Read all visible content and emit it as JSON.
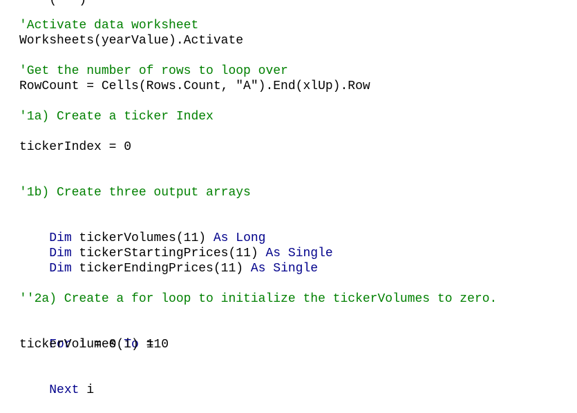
{
  "editor": {
    "clipped_top_fragment": "    (   )",
    "lines": [
      {
        "id": "c1",
        "text": "'Activate data worksheet"
      },
      {
        "id": "l1",
        "text": "Worksheets(yearValue).Activate"
      },
      {
        "id": "c2",
        "text": "'Get the number of rows to loop over"
      },
      {
        "id": "l2",
        "text": "RowCount = Cells(Rows.Count, \"A\").End(xlUp).Row"
      },
      {
        "id": "c3",
        "text": "'1a) Create a ticker Index"
      },
      {
        "id": "l3",
        "text": "tickerIndex = 0"
      },
      {
        "id": "c4",
        "text": "'1b) Create three output arrays"
      },
      {
        "id": "d1_kw",
        "text": "Dim"
      },
      {
        "id": "d1_name",
        "text": " tickerVolumes(11) "
      },
      {
        "id": "d1_type",
        "text": "As Long"
      },
      {
        "id": "d2_kw",
        "text": "Dim"
      },
      {
        "id": "d2_name",
        "text": " tickerStartingPrices(11) "
      },
      {
        "id": "d2_type",
        "text": "As Single"
      },
      {
        "id": "d3_kw",
        "text": "Dim"
      },
      {
        "id": "d3_name",
        "text": " tickerEndingPrices(11) "
      },
      {
        "id": "d3_type",
        "text": "As Single"
      },
      {
        "id": "c5",
        "text": "''2a) Create a for loop to initialize the tickerVolumes to zero."
      },
      {
        "id": "f1_kw1",
        "text": "For"
      },
      {
        "id": "f1_mid",
        "text": " i = 0 "
      },
      {
        "id": "f1_kw2",
        "text": "To"
      },
      {
        "id": "f1_end",
        "text": " 11"
      },
      {
        "id": "l4",
        "text": "tickerVolumes(i) = 0"
      },
      {
        "id": "n1_kw",
        "text": "Next"
      },
      {
        "id": "n1_var",
        "text": " i"
      }
    ]
  },
  "colors": {
    "comment": "#008000",
    "keyword": "#00008b",
    "text": "#000000",
    "background": "#ffffff"
  }
}
